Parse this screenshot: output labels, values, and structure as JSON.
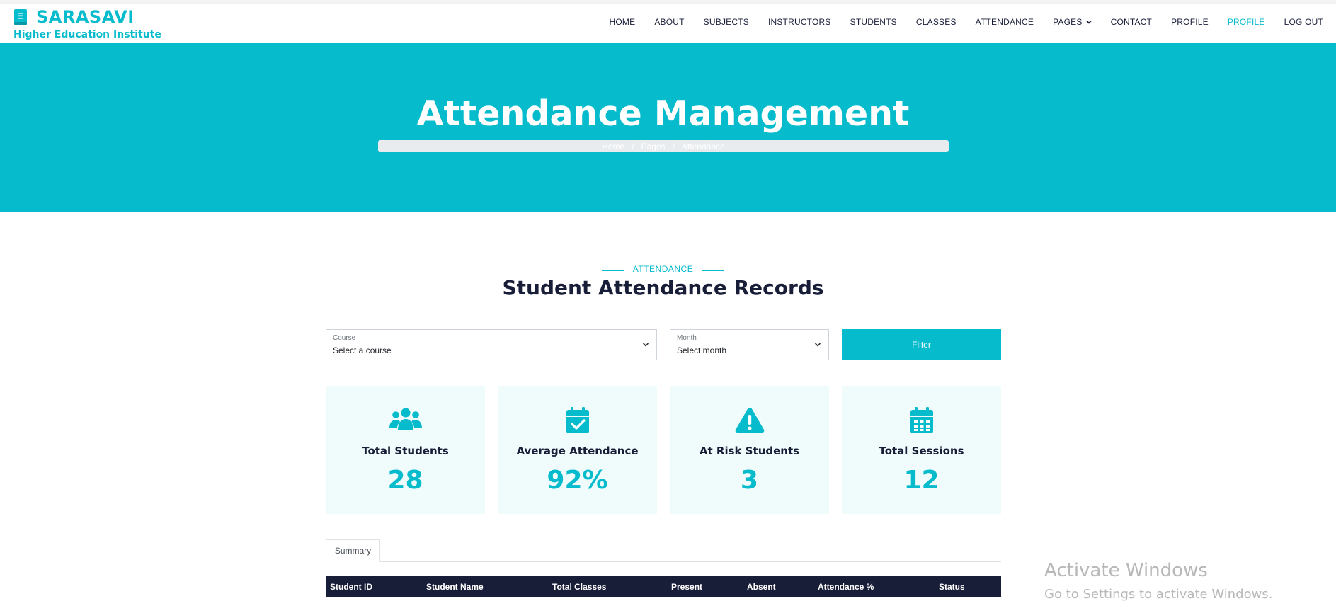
{
  "brand": {
    "title": "SARASAVI",
    "subtitle": "Higher Education Institute",
    "icon": "book-icon",
    "color": "#06bbcc"
  },
  "nav": {
    "items": [
      {
        "label": "HOME"
      },
      {
        "label": "ABOUT"
      },
      {
        "label": "SUBJECTS"
      },
      {
        "label": "INSTRUCTORS"
      },
      {
        "label": "STUDENTS"
      },
      {
        "label": "CLASSES"
      },
      {
        "label": "ATTENDANCE"
      },
      {
        "label": "PAGES"
      },
      {
        "label": "CONTACT"
      },
      {
        "label": "PROFILE"
      },
      {
        "label": "PROFILE"
      },
      {
        "label": "LOG OUT"
      }
    ],
    "active_color": "#06bbcc"
  },
  "hero": {
    "title": "Attendance Management",
    "breadcrumb": [
      "Home",
      "/",
      "Pages",
      "/",
      "Attendance"
    ],
    "background": "#06bbcc"
  },
  "section": {
    "tag": "ATTENDANCE",
    "title": "Student Attendance Records"
  },
  "filters": {
    "course": {
      "label": "Course",
      "value": "Select a course"
    },
    "month": {
      "label": "Month",
      "value": "Select month"
    },
    "button": "Filter"
  },
  "stats": [
    {
      "icon": "users-icon",
      "title": "Total Students",
      "value": "28"
    },
    {
      "icon": "calendar-check-icon",
      "title": "Average Attendance",
      "value": "92%"
    },
    {
      "icon": "warning-icon",
      "title": "At Risk Students",
      "value": "3"
    },
    {
      "icon": "calendar-icon",
      "title": "Total Sessions",
      "value": "12"
    }
  ],
  "tabs": [
    {
      "label": "Summary"
    }
  ],
  "table": {
    "columns": [
      "Student ID",
      "Student Name",
      "Total Classes",
      "Present",
      "Absent",
      "Attendance %",
      "Status"
    ]
  },
  "watermark": {
    "line1": "Activate Windows",
    "line2": "Go to Settings to activate Windows."
  }
}
